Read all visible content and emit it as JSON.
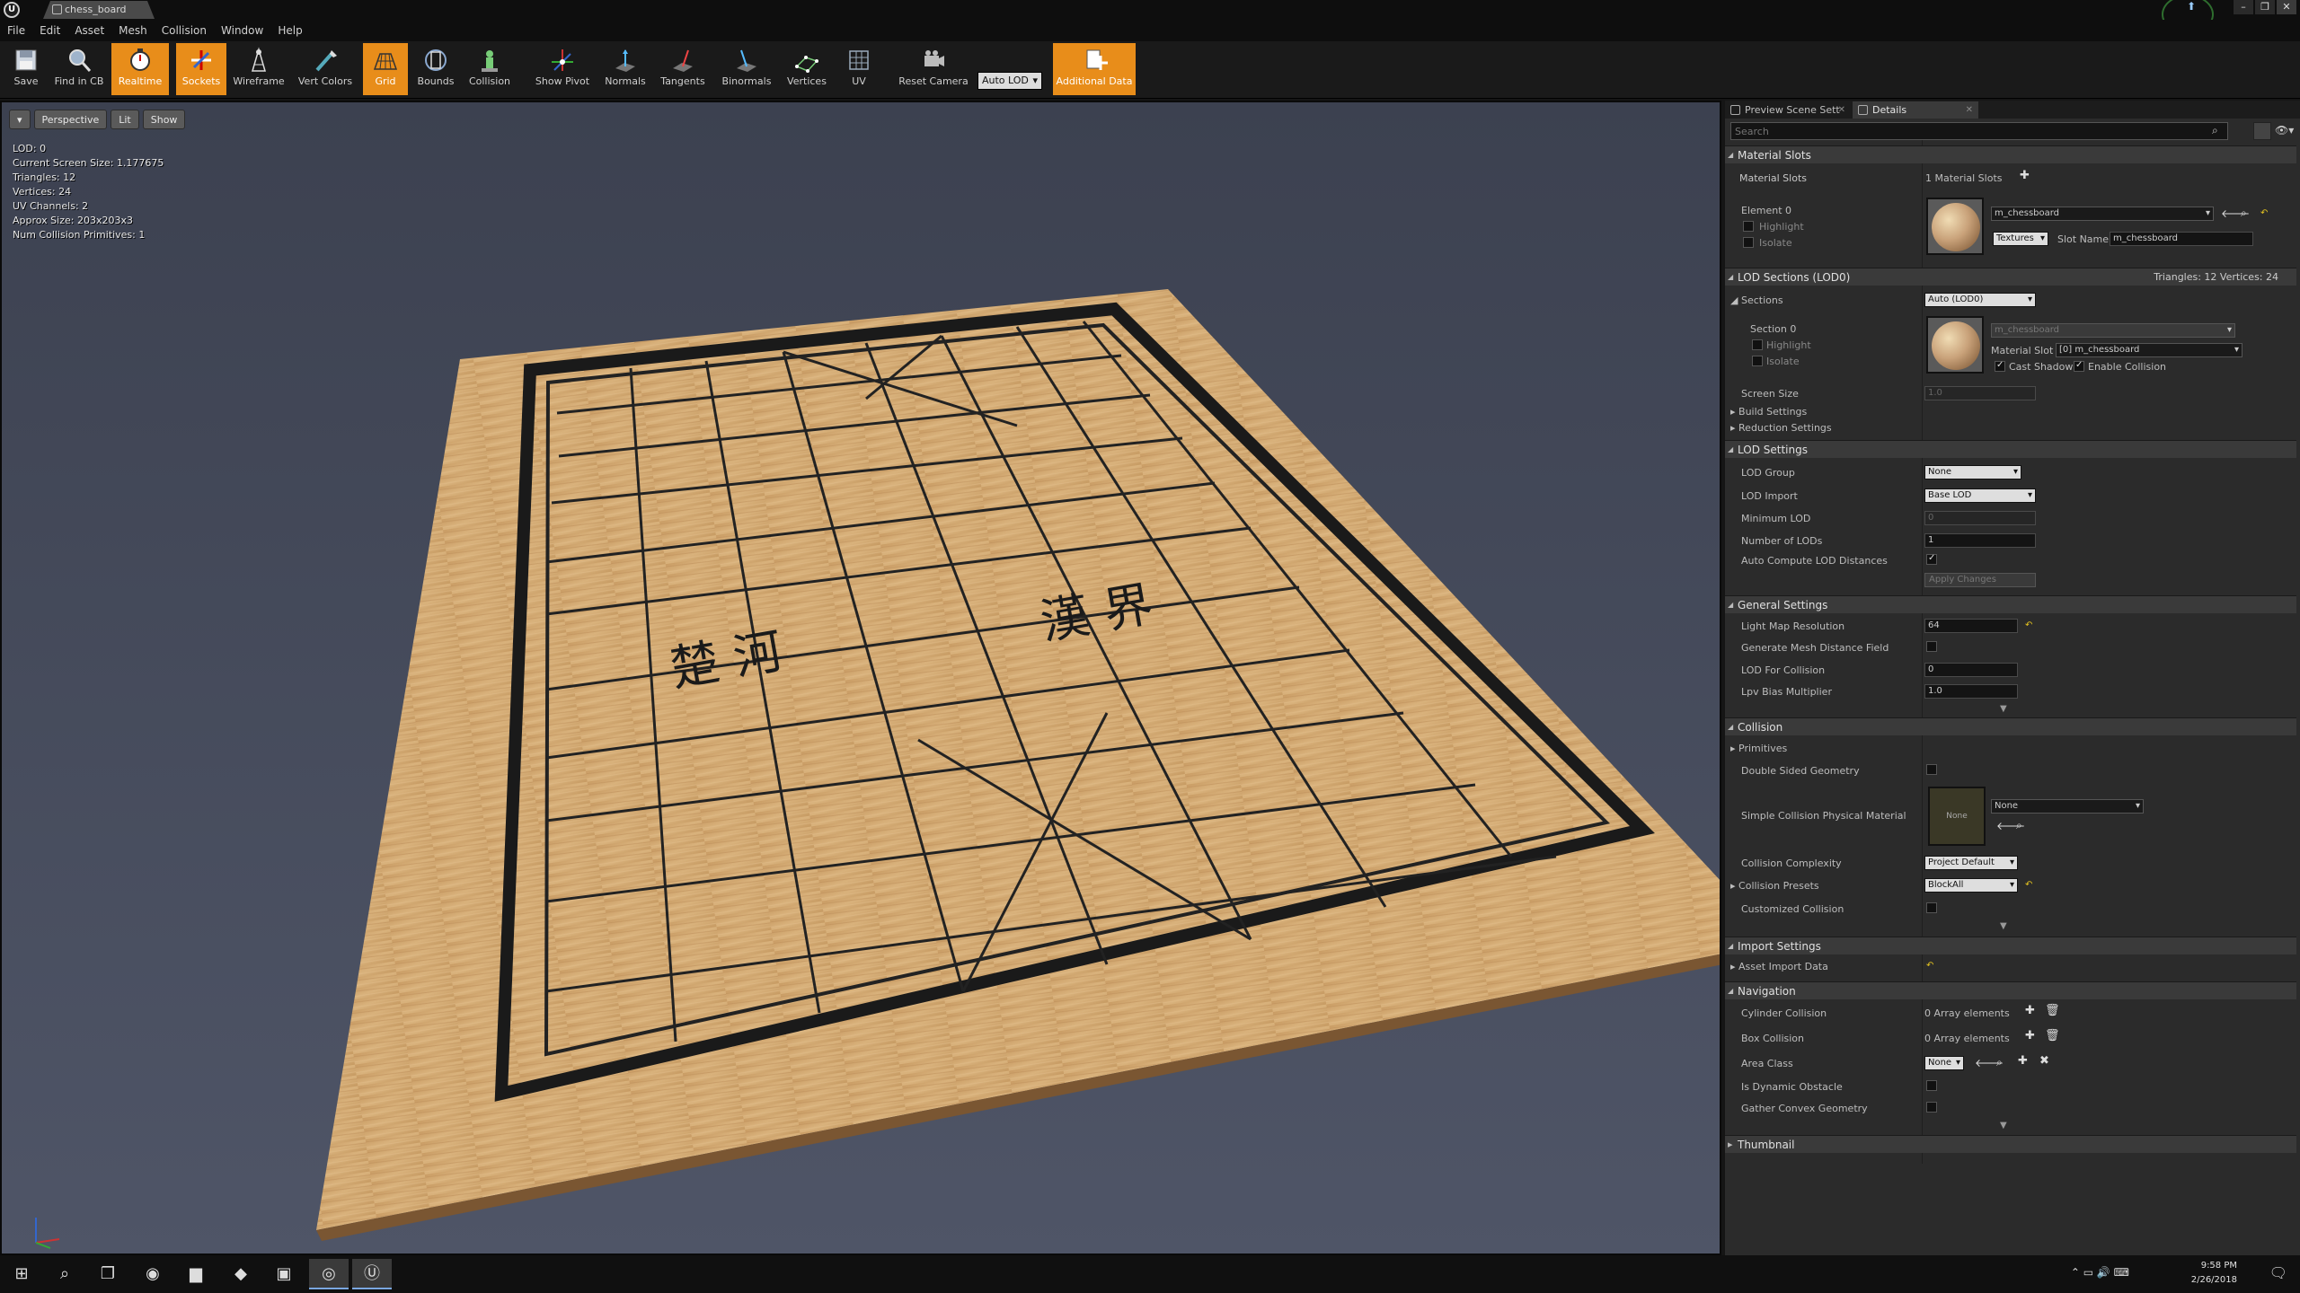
{
  "window": {
    "tab_title": "chess_board"
  },
  "menu": [
    "File",
    "Edit",
    "Asset",
    "Mesh",
    "Collision",
    "Window",
    "Help"
  ],
  "toolbar": {
    "save": "Save",
    "find_in_cb": "Find in CB",
    "realtime": "Realtime",
    "sockets": "Sockets",
    "wireframe": "Wireframe",
    "vert_colors": "Vert Colors",
    "grid": "Grid",
    "bounds": "Bounds",
    "collision": "Collision",
    "show_pivot": "Show Pivot",
    "normals": "Normals",
    "tangents": "Tangents",
    "binormals": "Binormals",
    "vertices": "Vertices",
    "uv": "UV",
    "auto_lod": "Auto LOD",
    "reset_camera": "Reset Camera",
    "additional_data": "Additional Data",
    "active_color": "#e88d1a"
  },
  "viewport": {
    "perspective": "Perspective",
    "lit": "Lit",
    "show": "Show",
    "info": [
      "LOD: 0",
      "Current Screen Size: 1.177675",
      "Triangles: 12",
      "Vertices: 24",
      "UV Channels: 2",
      "Approx Size: 203x203x3",
      "Num Collision Primitives: 1"
    ],
    "board_text_left": "楚 河",
    "board_text_right": "漢 界"
  },
  "panel": {
    "tab_preview": "Preview Scene Sett",
    "tab_details": "Details",
    "search_placeholder": "Search",
    "material_slots": {
      "header": "Material Slots",
      "label": "Material Slots",
      "count": "1 Material Slots",
      "element": "Element 0",
      "highlight": "Highlight",
      "isolate": "Isolate",
      "material": "m_chessboard",
      "textures": "Textures",
      "slot_name_label": "Slot Name",
      "slot_name": "m_chessboard"
    },
    "lod_sections": {
      "header": "LOD Sections (LOD0)",
      "stats": "Triangles: 12   Vertices: 24",
      "sections_label": "Sections",
      "sections_value": "Auto (LOD0)",
      "section": "Section 0",
      "highlight": "Highlight",
      "isolate": "Isolate",
      "material_dim": "m_chessboard",
      "material_slot_label": "Material Slot",
      "material_slot_value": "[0] m_chessboard",
      "cast_shadow": "Cast Shadow",
      "enable_collision": "Enable Collision",
      "screen_size_label": "Screen Size",
      "screen_size_value": "1.0",
      "build_settings": "Build Settings",
      "reduction_settings": "Reduction Settings"
    },
    "lod_settings": {
      "header": "LOD Settings",
      "lod_group": "LOD Group",
      "lod_group_value": "None",
      "lod_import": "LOD Import",
      "lod_import_value": "Base LOD",
      "min_lod": "Minimum LOD",
      "min_lod_value": "0",
      "num_lods": "Number of LODs",
      "num_lods_value": "1",
      "auto_compute": "Auto Compute LOD Distances",
      "apply_changes": "Apply Changes"
    },
    "general": {
      "header": "General Settings",
      "light_map": "Light Map Resolution",
      "light_map_value": "64",
      "gen_mesh": "Generate Mesh Distance Field",
      "lod_for_collision": "LOD For Collision",
      "lod_for_collision_value": "0",
      "lpv_bias": "Lpv Bias Multiplier",
      "lpv_bias_value": "1.0"
    },
    "collision": {
      "header": "Collision",
      "primitives": "Primitives",
      "double_sided": "Double Sided Geometry",
      "simple_phys": "Simple Collision Physical Material",
      "phys_thumb": "None",
      "phys_value": "None",
      "complexity": "Collision Complexity",
      "complexity_value": "Project Default",
      "presets": "Collision Presets",
      "presets_value": "BlockAll",
      "customized": "Customized Collision"
    },
    "import": {
      "header": "Import Settings",
      "asset_import": "Asset Import Data"
    },
    "navigation": {
      "header": "Navigation",
      "cylinder": "Cylinder Collision",
      "cylinder_value": "0 Array elements",
      "box": "Box Collision",
      "box_value": "0 Array elements",
      "area_class": "Area Class",
      "area_class_value": "None",
      "dynamic_obstacle": "Is Dynamic Obstacle",
      "gather_convex": "Gather Convex Geometry"
    },
    "thumbnail": {
      "header": "Thumbnail"
    }
  },
  "taskbar": {
    "time": "9:58 PM",
    "date": "2/26/2018"
  }
}
